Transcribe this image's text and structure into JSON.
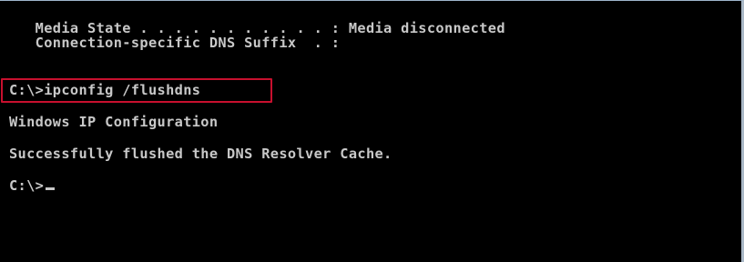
{
  "console": {
    "lines": {
      "media_state": "   Media State . . . . . . . . . . . : Media disconnected",
      "dns_suffix": "   Connection-specific DNS Suffix  . :",
      "command": "C:\\>ipconfig /flushdns",
      "ip_config_header": "Windows IP Configuration",
      "flush_result": "Successfully flushed the DNS Resolver Cache.",
      "prompt": "C:\\>"
    },
    "colors": {
      "background": "#000000",
      "text": "#c8c8c8",
      "highlight_border": "#c8102e"
    }
  }
}
